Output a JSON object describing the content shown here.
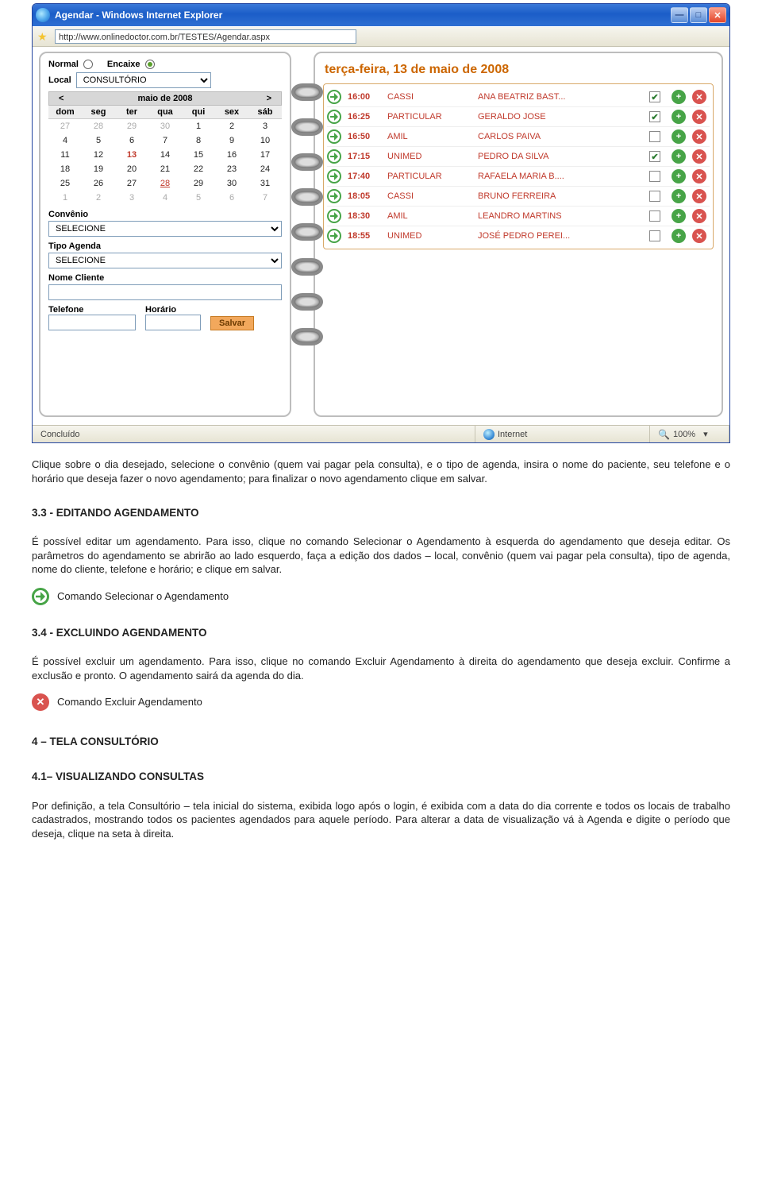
{
  "window": {
    "title": "Agendar - Windows Internet Explorer",
    "url": "http://www.onlinedoctor.com.br/TESTES/Agendar.aspx"
  },
  "leftPage": {
    "radioNormal": "Normal",
    "radioEncaixe": "Encaixe",
    "localLabel": "Local",
    "localValue": "CONSULTÓRIO",
    "calendar": {
      "monthLabel": "maio de 2008",
      "prev": "<",
      "next": ">",
      "weekdays": [
        "dom",
        "seg",
        "ter",
        "qua",
        "qui",
        "sex",
        "sáb"
      ],
      "rows": [
        [
          {
            "d": "27",
            "dim": true
          },
          {
            "d": "28",
            "dim": true
          },
          {
            "d": "29",
            "dim": true
          },
          {
            "d": "30",
            "dim": true
          },
          {
            "d": "1"
          },
          {
            "d": "2"
          },
          {
            "d": "3"
          }
        ],
        [
          {
            "d": "4"
          },
          {
            "d": "5"
          },
          {
            "d": "6"
          },
          {
            "d": "7"
          },
          {
            "d": "8"
          },
          {
            "d": "9"
          },
          {
            "d": "10"
          }
        ],
        [
          {
            "d": "11"
          },
          {
            "d": "12"
          },
          {
            "d": "13",
            "today": true
          },
          {
            "d": "14"
          },
          {
            "d": "15"
          },
          {
            "d": "16"
          },
          {
            "d": "17"
          }
        ],
        [
          {
            "d": "18"
          },
          {
            "d": "19"
          },
          {
            "d": "20"
          },
          {
            "d": "21"
          },
          {
            "d": "22"
          },
          {
            "d": "23"
          },
          {
            "d": "24"
          }
        ],
        [
          {
            "d": "25"
          },
          {
            "d": "26"
          },
          {
            "d": "27"
          },
          {
            "d": "28",
            "mark": true
          },
          {
            "d": "29"
          },
          {
            "d": "30"
          },
          {
            "d": "31"
          }
        ],
        [
          {
            "d": "1",
            "dim": true
          },
          {
            "d": "2",
            "dim": true
          },
          {
            "d": "3",
            "dim": true
          },
          {
            "d": "4",
            "dim": true
          },
          {
            "d": "5",
            "dim": true
          },
          {
            "d": "6",
            "dim": true
          },
          {
            "d": "7",
            "dim": true
          }
        ]
      ]
    },
    "convenioLabel": "Convênio",
    "convenioValue": "SELECIONE",
    "tipoAgendaLabel": "Tipo Agenda",
    "tipoAgendaValue": "SELECIONE",
    "nomeClienteLabel": "Nome Cliente",
    "nomeClienteValue": "",
    "telefoneLabel": "Telefone",
    "telefoneValue": "",
    "horarioLabel": "Horário",
    "horarioValue": "",
    "salvarLabel": "Salvar"
  },
  "rightPage": {
    "title": "terça-feira, 13 de maio de 2008",
    "appointments": [
      {
        "time": "16:00",
        "plan": "CASSI",
        "name": "ANA BEATRIZ BAST...",
        "checked": true
      },
      {
        "time": "16:25",
        "plan": "PARTICULAR",
        "name": "GERALDO JOSE",
        "checked": true
      },
      {
        "time": "16:50",
        "plan": "AMIL",
        "name": "CARLOS PAIVA",
        "checked": false
      },
      {
        "time": "17:15",
        "plan": "UNIMED",
        "name": "PEDRO DA SILVA",
        "checked": true
      },
      {
        "time": "17:40",
        "plan": "PARTICULAR",
        "name": "RAFAELA MARIA B....",
        "checked": false
      },
      {
        "time": "18:05",
        "plan": "CASSI",
        "name": "BRUNO FERREIRA",
        "checked": false
      },
      {
        "time": "18:30",
        "plan": "AMIL",
        "name": "LEANDRO MARTINS",
        "checked": false
      },
      {
        "time": "18:55",
        "plan": "UNIMED",
        "name": "JOSÉ PEDRO PEREI...",
        "checked": false
      }
    ]
  },
  "statusbar": {
    "left": "Concluído",
    "zone": "Internet",
    "zoom": "100%"
  },
  "doc": {
    "p1": "Clique sobre o dia desejado, selecione o convênio (quem vai pagar pela consulta), e o tipo de agenda, insira o nome do paciente, seu telefone e o horário que deseja fazer o novo agendamento; para finalizar o novo agendamento clique em salvar.",
    "h33": "3.3 - EDITANDO AGENDAMENTO",
    "p33": "É possível editar um agendamento. Para isso, clique no comando Selecionar o Agendamento à esquerda do agendamento que deseja editar. Os parâmetros do agendamento se abrirão ao lado esquerdo, faça a edição dos dados – local, convênio (quem vai pagar pela consulta), tipo de agenda, nome do cliente, telefone e horário; e clique em salvar.",
    "cmdSel": "Comando Selecionar o Agendamento",
    "h34": "3.4 - EXCLUINDO AGENDAMENTO",
    "p34": "É possível excluir um agendamento. Para isso, clique no comando Excluir Agendamento à direita do agendamento que deseja excluir. Confirme a exclusão e pronto. O agendamento sairá da agenda do dia.",
    "cmdDel": "Comando Excluir Agendamento",
    "h4": "4 – TELA CONSULTÓRIO",
    "h41": "4.1– VISUALIZANDO CONSULTAS",
    "p41": "Por definição, a tela Consultório – tela inicial do sistema, exibida logo após o login, é exibida com a data do dia corrente e todos os locais de trabalho cadastrados, mostrando todos os pacientes agendados para aquele período. Para alterar a data de visualização vá à Agenda e digite o período que deseja, clique na seta à direita."
  }
}
